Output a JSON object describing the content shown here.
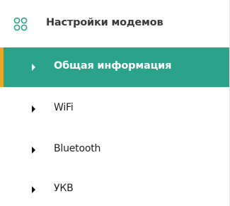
{
  "colors": {
    "active_bg": "#2aa38a",
    "active_border": "#e9a825",
    "icon_color": "#2aa38a"
  },
  "menu": {
    "title": "Настройки модемов",
    "icon": "group-settings-icon",
    "items": [
      {
        "label": "Общая информация",
        "active": true
      },
      {
        "label": "WiFi",
        "active": false
      },
      {
        "label": "Bluetooth",
        "active": false
      },
      {
        "label": "УКВ",
        "active": false
      }
    ]
  }
}
